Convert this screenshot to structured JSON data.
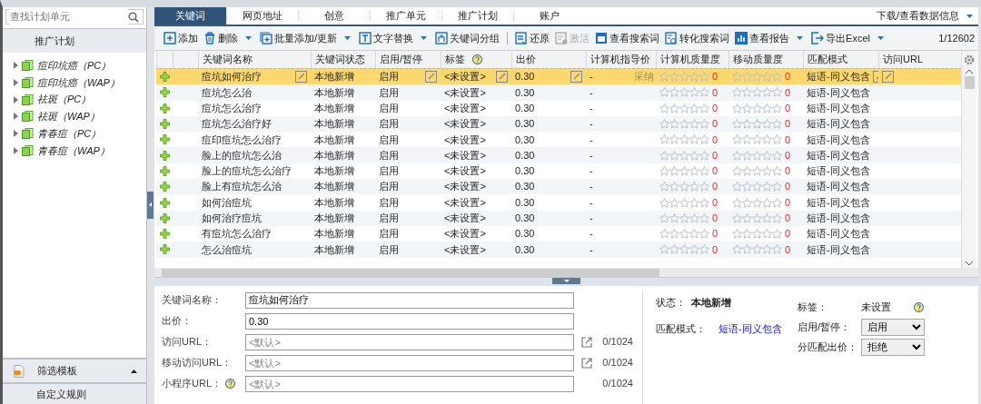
{
  "sidebar": {
    "search": {
      "placeholder": "查找计划单元"
    },
    "header": "推广计划",
    "items": [
      {
        "label": "痘印坑癌（PC）",
        "expanded": false
      },
      {
        "label": "痘印坑癌（WAP）",
        "expanded": false
      },
      {
        "label": "祛斑（PC）",
        "expanded": false
      },
      {
        "label": "祛斑（WAP）",
        "expanded": false
      },
      {
        "label": "青春痘（PC）",
        "expanded": false
      },
      {
        "label": "青春痘（WAP）",
        "expanded": false
      }
    ],
    "filter_panel": {
      "title": "筛选模板"
    },
    "custom_rule": "自定义规则"
  },
  "tabs": [
    {
      "label": "关键词",
      "selected": true
    },
    {
      "label": "网页地址",
      "selected": false
    },
    {
      "label": "创意",
      "selected": false
    },
    {
      "label": "推广单元",
      "selected": false
    },
    {
      "label": "推广计划",
      "selected": false
    },
    {
      "label": "账户",
      "selected": false
    }
  ],
  "download_menu": "下载/查看数据信息",
  "toolbar": [
    {
      "kind": "add",
      "label": "添加",
      "dropdown": false,
      "disabled": false
    },
    {
      "kind": "delete",
      "label": "删除",
      "dropdown": true,
      "disabled": false
    },
    {
      "kind": "batch",
      "label": "批量添加/更新",
      "dropdown": true,
      "disabled": false
    },
    {
      "kind": "replace",
      "label": "文字替换",
      "dropdown": true,
      "disabled": false
    },
    {
      "kind": "group",
      "label": "关键词分组",
      "dropdown": false,
      "disabled": false
    },
    {
      "kind": "separator"
    },
    {
      "kind": "restore",
      "label": "还原",
      "dropdown": false,
      "disabled": false
    },
    {
      "kind": "activate",
      "label": "激活",
      "dropdown": false,
      "disabled": true
    },
    {
      "kind": "search",
      "label": "查看搜索词",
      "dropdown": false,
      "disabled": false
    },
    {
      "kind": "convert",
      "label": "转化搜索词",
      "dropdown": false,
      "disabled": false
    },
    {
      "kind": "report",
      "label": "查看报告",
      "dropdown": true,
      "disabled": false
    },
    {
      "kind": "export",
      "label": "导出Excel",
      "dropdown": true,
      "disabled": false
    }
  ],
  "page_counter": "1/12602",
  "table": {
    "columns": [
      "关键词名称",
      "关键词状态",
      "启用/暂停",
      "标签",
      "出价",
      "计算机指导价",
      "计算机质量度",
      "移动质量度",
      "匹配模式",
      "访问URL"
    ],
    "rows": [
      {
        "selected": true,
        "name": "痘坑如何治疗",
        "status": "本地新增",
        "enable": "启用",
        "tag": "<未设置>",
        "bid": "0.30",
        "guide": "-",
        "guide_note": "采纳",
        "pc_quality": {
          "stars": 0,
          "score": "0"
        },
        "mobile_quality": {
          "stars": 0,
          "score": "0"
        },
        "match": "短语-同义包含"
      },
      {
        "selected": false,
        "name": "痘坑怎么治",
        "status": "本地新增",
        "enable": "启用",
        "tag": "<未设置>",
        "bid": "0.30",
        "guide": "-",
        "pc_quality": {
          "stars": 0,
          "score": "0"
        },
        "mobile_quality": {
          "stars": 0,
          "score": "0"
        },
        "match": "短语-同义包含"
      },
      {
        "selected": false,
        "name": "痘坑怎么治疗",
        "status": "本地新增",
        "enable": "启用",
        "tag": "<未设置>",
        "bid": "0.30",
        "guide": "-",
        "pc_quality": {
          "stars": 0,
          "score": "0"
        },
        "mobile_quality": {
          "stars": 0,
          "score": "0"
        },
        "match": "短语-同义包含"
      },
      {
        "selected": false,
        "name": "痘坑怎么治疗好",
        "status": "本地新增",
        "enable": "启用",
        "tag": "<未设置>",
        "bid": "0.30",
        "guide": "-",
        "pc_quality": {
          "stars": 0,
          "score": "0"
        },
        "mobile_quality": {
          "stars": 0,
          "score": "0"
        },
        "match": "短语-同义包含"
      },
      {
        "selected": false,
        "name": "痘印痘坑怎么治疗",
        "status": "本地新增",
        "enable": "启用",
        "tag": "<未设置>",
        "bid": "0.30",
        "guide": "-",
        "pc_quality": {
          "stars": 0,
          "score": "0"
        },
        "mobile_quality": {
          "stars": 0,
          "score": "0"
        },
        "match": "短语-同义包含"
      },
      {
        "selected": false,
        "name": "脸上的痘坑怎么治",
        "status": "本地新增",
        "enable": "启用",
        "tag": "<未设置>",
        "bid": "0.30",
        "guide": "-",
        "pc_quality": {
          "stars": 0,
          "score": "0"
        },
        "mobile_quality": {
          "stars": 0,
          "score": "0"
        },
        "match": "短语-同义包含"
      },
      {
        "selected": false,
        "name": "脸上的痘坑怎么治疗",
        "status": "本地新增",
        "enable": "启用",
        "tag": "<未设置>",
        "bid": "0.30",
        "guide": "-",
        "pc_quality": {
          "stars": 0,
          "score": "0"
        },
        "mobile_quality": {
          "stars": 0,
          "score": "0"
        },
        "match": "短语-同义包含"
      },
      {
        "selected": false,
        "name": "脸上有痘坑怎么治",
        "status": "本地新增",
        "enable": "启用",
        "tag": "<未设置>",
        "bid": "0.30",
        "guide": "-",
        "pc_quality": {
          "stars": 0,
          "score": "0"
        },
        "mobile_quality": {
          "stars": 0,
          "score": "0"
        },
        "match": "短语-同义包含"
      },
      {
        "selected": false,
        "name": "如何治痘坑",
        "status": "本地新增",
        "enable": "启用",
        "tag": "<未设置>",
        "bid": "0.30",
        "guide": "-",
        "pc_quality": {
          "stars": 0,
          "score": "0"
        },
        "mobile_quality": {
          "stars": 0,
          "score": "0"
        },
        "match": "短语-同义包含"
      },
      {
        "selected": false,
        "name": "如何治疗痘坑",
        "status": "本地新增",
        "enable": "启用",
        "tag": "<未设置>",
        "bid": "0.30",
        "guide": "-",
        "pc_quality": {
          "stars": 0,
          "score": "0"
        },
        "mobile_quality": {
          "stars": 0,
          "score": "0"
        },
        "match": "短语-同义包含"
      },
      {
        "selected": false,
        "name": "有痘坑怎么治疗",
        "status": "本地新增",
        "enable": "启用",
        "tag": "<未设置>",
        "bid": "0.30",
        "guide": "-",
        "pc_quality": {
          "stars": 0,
          "score": "0"
        },
        "mobile_quality": {
          "stars": 0,
          "score": "0"
        },
        "match": "短语-同义包含"
      },
      {
        "selected": false,
        "name": "怎么治痘坑",
        "status": "本地新增",
        "enable": "启用",
        "tag": "<未设置>",
        "bid": "0.30",
        "guide": "-",
        "pc_quality": {
          "stars": 0,
          "score": "0"
        },
        "mobile_quality": {
          "stars": 0,
          "score": "0"
        },
        "match": "短语-同义包含"
      }
    ]
  },
  "detail": {
    "fields": [
      {
        "kind": "value",
        "label": "关键词名称：",
        "value": "痘坑如何治疗"
      },
      {
        "kind": "value",
        "label": "出价：",
        "value": "0.30"
      },
      {
        "kind": "url",
        "label": "访问URL：",
        "placeholder": "<默认>",
        "counter": "0/1024"
      },
      {
        "kind": "url",
        "label": "移动访问URL：",
        "placeholder": "<默认>",
        "counter": "0/1024"
      },
      {
        "kind": "help_url",
        "label": "小程序URL：",
        "placeholder": "<默认>",
        "counter": "0/1024"
      }
    ],
    "status_label": "状态：",
    "status": "本地新增",
    "match_label": "匹配模式：",
    "match": "短语-同义包含",
    "tag_label": "标签：",
    "tag": "未设置",
    "enable_label": "启用/暂停：",
    "enable": "启用",
    "partial_label": "分匹配出价：",
    "partial": "拒绝"
  }
}
